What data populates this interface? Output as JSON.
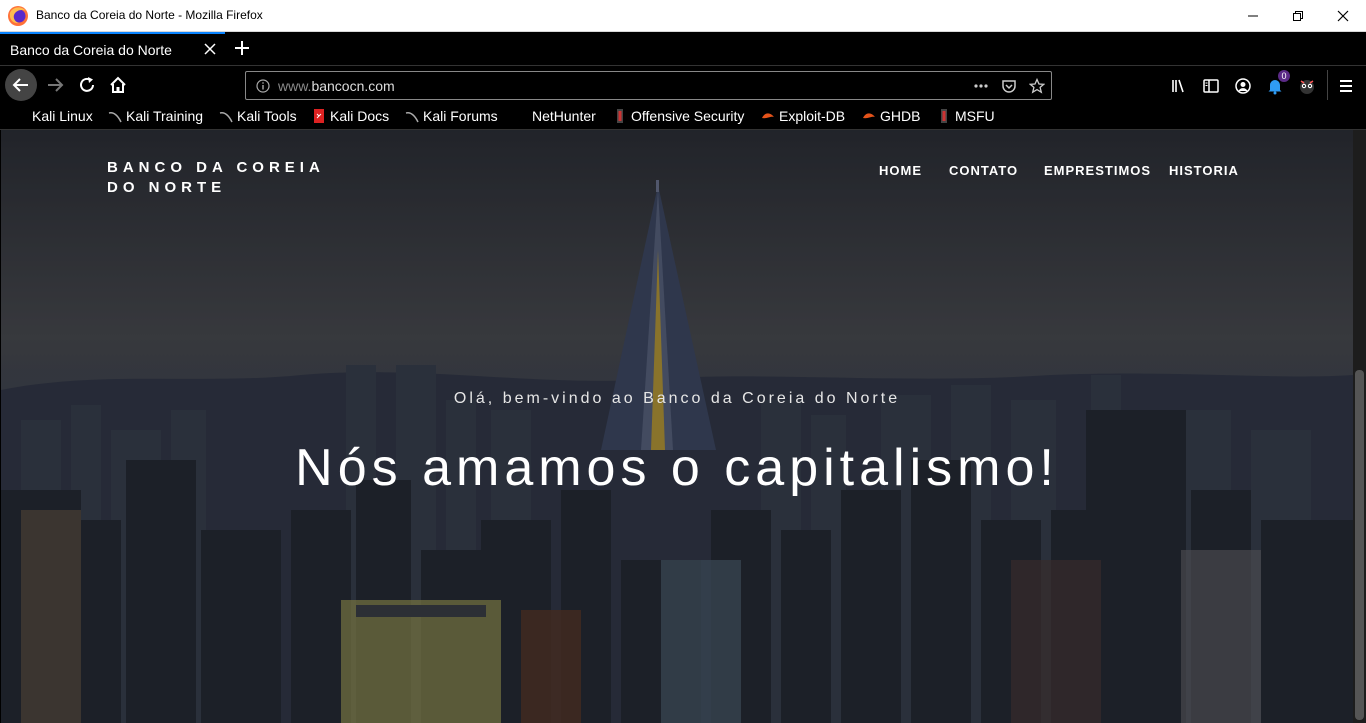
{
  "window": {
    "title": "Banco da Coreia do Norte - Mozilla Firefox"
  },
  "tabs": [
    {
      "label": "Banco da Coreia do Norte",
      "active": true
    }
  ],
  "urlbar": {
    "url_prefix": "www.",
    "url_domain": "bancocn.com"
  },
  "toolbar": {
    "notification_count": "0"
  },
  "bookmarks": [
    {
      "label": "Kali Linux",
      "icon": "kali-icon"
    },
    {
      "label": "Kali Training",
      "icon": "kali-icon"
    },
    {
      "label": "Kali Tools",
      "icon": "kali-icon"
    },
    {
      "label": "Kali Docs",
      "icon": "kali-docs-icon"
    },
    {
      "label": "Kali Forums",
      "icon": "kali-icon"
    },
    {
      "label": "NetHunter",
      "icon": "nethunter-icon"
    },
    {
      "label": "Offensive Security",
      "icon": "offsec-icon"
    },
    {
      "label": "Exploit-DB",
      "icon": "exploitdb-icon"
    },
    {
      "label": "GHDB",
      "icon": "exploitdb-icon"
    },
    {
      "label": "MSFU",
      "icon": "offsec-icon"
    }
  ],
  "site": {
    "brand_line1": "BANCO DA COREIA",
    "brand_line2": "DO NORTE",
    "nav": [
      "HOME",
      "CONTATO",
      "EMPRESTIMOS",
      "HISTORIA"
    ],
    "hero_subtitle": "Olá, bem-vindo ao Banco da Coreia do Norte",
    "hero_title": "Nós amamos o capitalismo!"
  },
  "colors": {
    "tab_accent": "#0a84ff",
    "browser_dark": "#000000",
    "hero_text": "#ffffff"
  }
}
